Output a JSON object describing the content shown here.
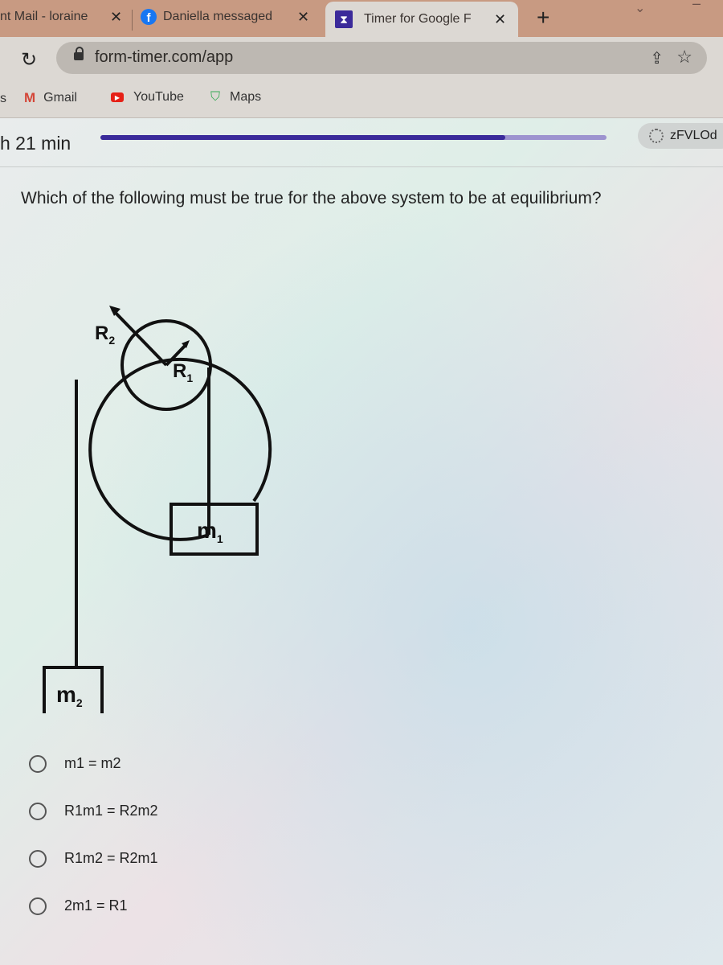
{
  "browser": {
    "tabs": [
      {
        "title": "nt Mail - loraine",
        "icon": "mail-icon",
        "active": false
      },
      {
        "title": "Daniella messaged",
        "icon": "facebook-icon",
        "active": false
      },
      {
        "title": "Timer for Google F",
        "icon": "hourglass-icon",
        "active": true
      }
    ],
    "new_tab_label": "+",
    "close_glyph": "✕",
    "url": "form-timer.com/app",
    "bookmarks": [
      {
        "label": "Gmail",
        "icon": "gmail-icon"
      },
      {
        "label": "YouTube",
        "icon": "youtube-icon"
      },
      {
        "label": "Maps",
        "icon": "maps-icon"
      }
    ],
    "bookmarks_cut_label": "s"
  },
  "timer": {
    "remaining_text": "h 21 min",
    "progress_percent": 80,
    "user_id": "zFVLOd",
    "accent_color": "#3a2a9a"
  },
  "question": {
    "text": "Which of the following must be true for the above system to be at equilibrium?",
    "diagram_labels": {
      "r2": "R",
      "r2_sub": "2",
      "r1": "R",
      "r1_sub": "1",
      "m1": "m",
      "m1_sub": "1",
      "m2": "m",
      "m2_sub": "2"
    },
    "options": [
      {
        "label": "m1 = m2",
        "selected": false
      },
      {
        "label": "R1m1 = R2m2",
        "selected": false
      },
      {
        "label": "R1m2 = R2m1",
        "selected": false
      },
      {
        "label": "2m1 = R1",
        "selected": false
      }
    ]
  }
}
